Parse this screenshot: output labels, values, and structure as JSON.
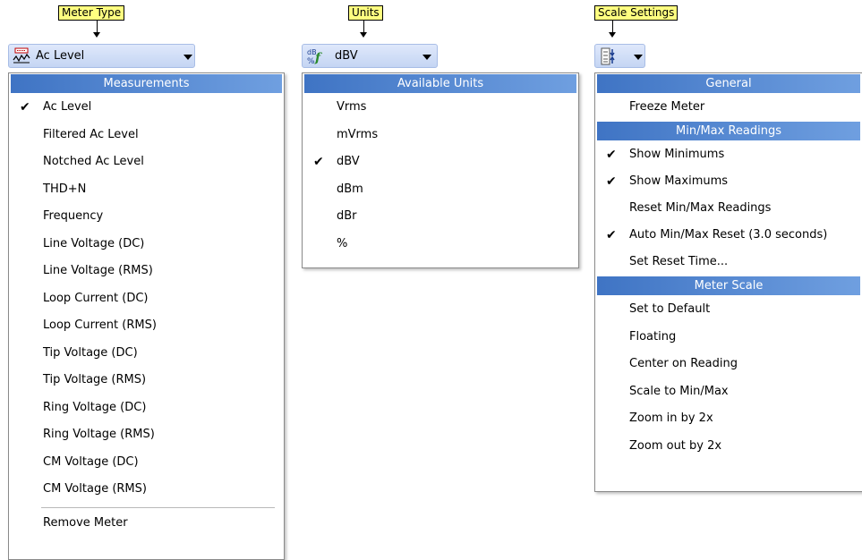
{
  "callouts": {
    "meter_type": "Meter Type",
    "units": "Units",
    "scale_settings": "Scale Settings"
  },
  "meter_dropdown": {
    "selected": "Ac Level",
    "icon": "meter-chart-icon"
  },
  "units_dropdown": {
    "selected": "dBV",
    "icon": "db-units-icon"
  },
  "scale_dropdown": {
    "icon": "scale-settings-icon"
  },
  "measurements_menu": {
    "header": "Measurements",
    "items": [
      {
        "label": "Ac Level",
        "checked": true
      },
      {
        "label": "Filtered Ac Level",
        "checked": false
      },
      {
        "label": "Notched Ac Level",
        "checked": false
      },
      {
        "label": "THD+N",
        "checked": false
      },
      {
        "label": "Frequency",
        "checked": false
      },
      {
        "label": "Line Voltage (DC)",
        "checked": false
      },
      {
        "label": "Line Voltage (RMS)",
        "checked": false
      },
      {
        "label": "Loop Current (DC)",
        "checked": false
      },
      {
        "label": "Loop Current (RMS)",
        "checked": false
      },
      {
        "label": "Tip Voltage (DC)",
        "checked": false
      },
      {
        "label": "Tip Voltage (RMS)",
        "checked": false
      },
      {
        "label": "Ring Voltage (DC)",
        "checked": false
      },
      {
        "label": "Ring Voltage (RMS)",
        "checked": false
      },
      {
        "label": "CM Voltage (DC)",
        "checked": false
      },
      {
        "label": "CM Voltage (RMS)",
        "checked": false
      }
    ],
    "remove": "Remove Meter"
  },
  "units_menu": {
    "header": "Available Units",
    "items": [
      {
        "label": "Vrms",
        "checked": false
      },
      {
        "label": "mVrms",
        "checked": false
      },
      {
        "label": "dBV",
        "checked": true
      },
      {
        "label": "dBm",
        "checked": false
      },
      {
        "label": "dBr",
        "checked": false
      },
      {
        "label": "%",
        "checked": false
      }
    ]
  },
  "scale_menu": {
    "general_header": "General",
    "freeze": "Freeze Meter",
    "minmax_header": "Min/Max Readings",
    "minmax_items": [
      {
        "label": "Show Minimums",
        "checked": true
      },
      {
        "label": "Show Maximums",
        "checked": true
      },
      {
        "label": "Reset Min/Max Readings",
        "checked": false
      },
      {
        "label": "Auto Min/Max Reset (3.0 seconds)",
        "checked": true
      },
      {
        "label": "Set Reset Time...",
        "checked": false
      }
    ],
    "scale_header": "Meter Scale",
    "scale_items": [
      {
        "label": "Set to Default"
      },
      {
        "label": "Floating"
      },
      {
        "label": "Center on Reading"
      },
      {
        "label": "Scale to Min/Max"
      },
      {
        "label": "Zoom in by 2x"
      },
      {
        "label": "Zoom out by 2x"
      }
    ]
  },
  "check_mark": "✔"
}
